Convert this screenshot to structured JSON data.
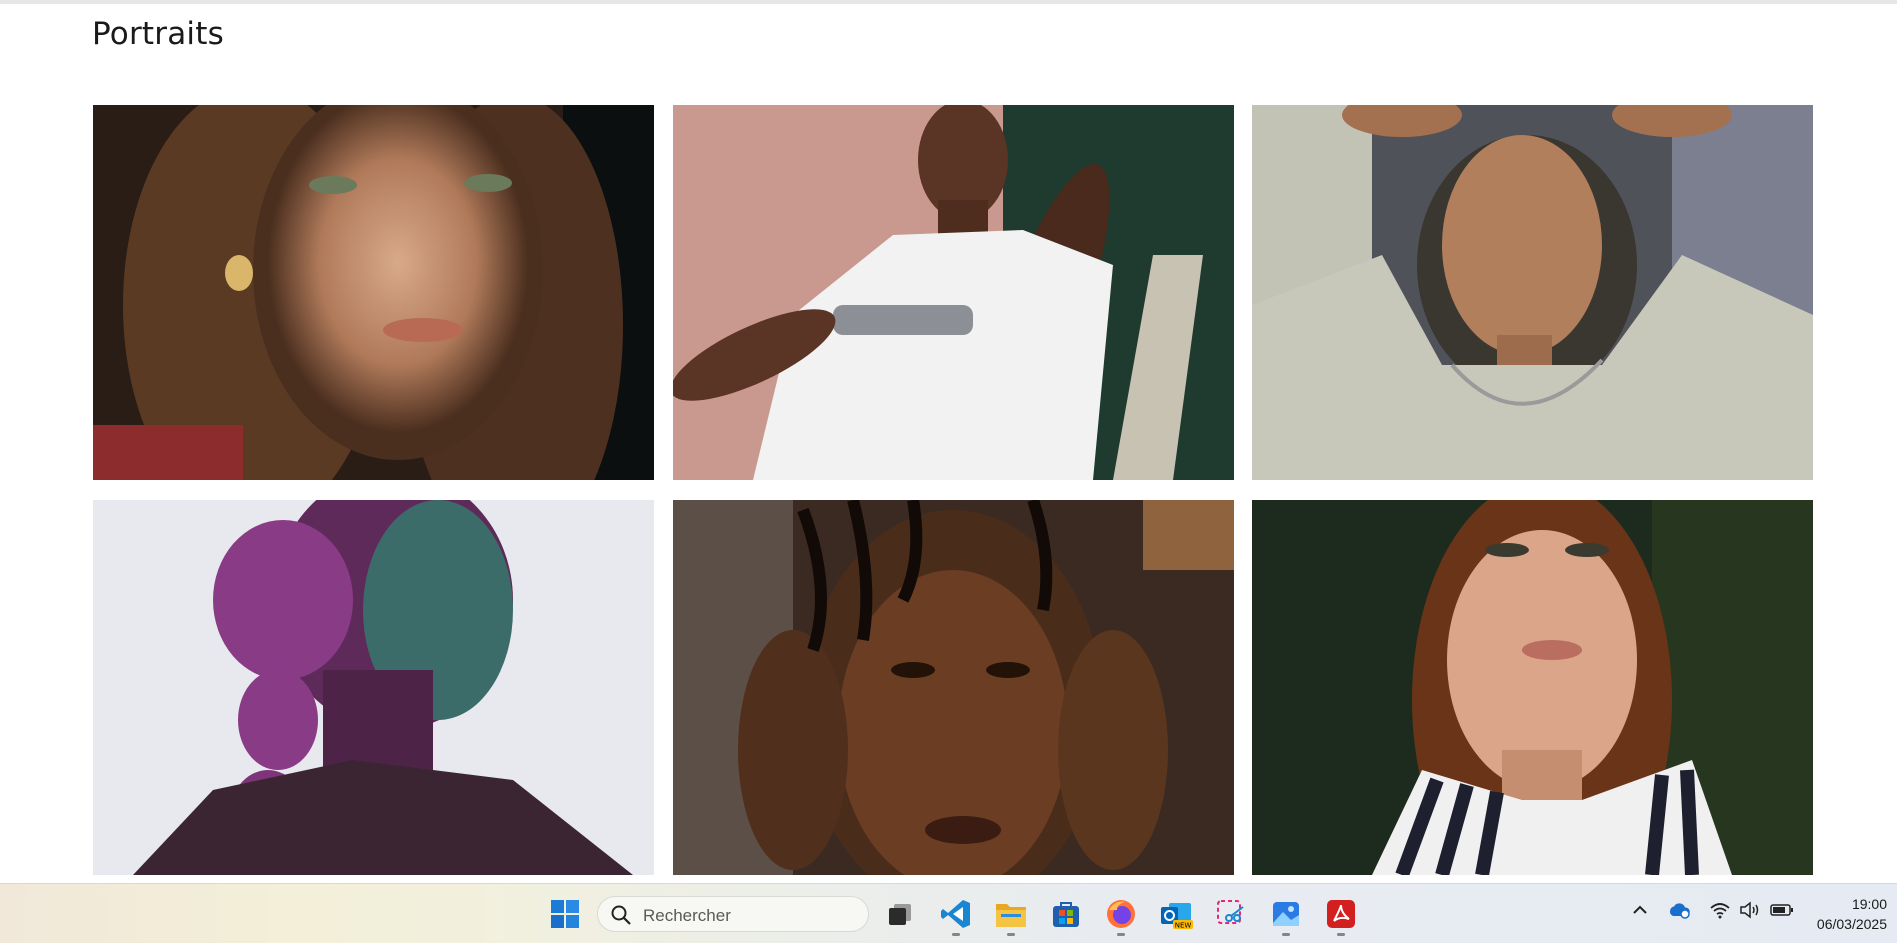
{
  "page": {
    "title": "Portraits"
  },
  "gallery": {
    "photos": [
      {
        "alt": "Portrait 1"
      },
      {
        "alt": "Portrait 2"
      },
      {
        "alt": "Portrait 3"
      },
      {
        "alt": "Portrait 4"
      },
      {
        "alt": "Portrait 5"
      },
      {
        "alt": "Portrait 6"
      }
    ]
  },
  "taskbar": {
    "search_placeholder": "Rechercher",
    "apps": [
      "start-icon",
      "task-view-icon",
      "vscode-icon",
      "file-explorer-icon",
      "store-icon",
      "firefox-icon",
      "outlook-icon",
      "snipping-tool-icon",
      "photos-icon",
      "acrobat-icon"
    ],
    "tray": [
      "chevron-up-icon",
      "onedrive-icon",
      "wifi-icon",
      "volume-icon",
      "battery-icon"
    ],
    "time": "19:00",
    "date": "06/03/2025"
  }
}
